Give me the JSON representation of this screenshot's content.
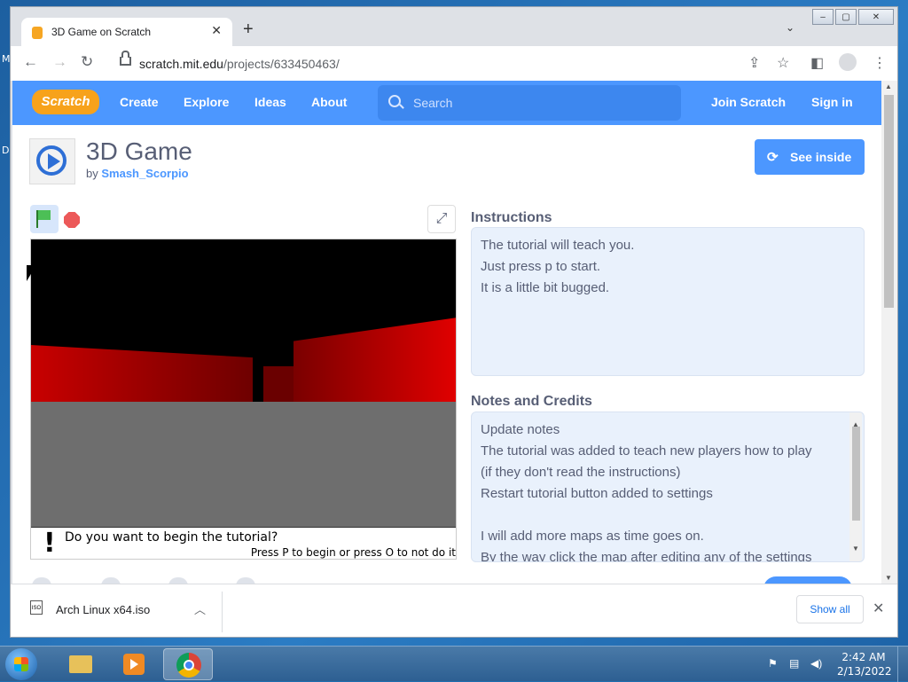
{
  "desktop": {
    "letters": [
      "M",
      "D"
    ]
  },
  "browser": {
    "tab_title": "3D Game on Scratch",
    "new_tab": "+",
    "tab_search_icon": "chevron-down-icon",
    "url_host": "scratch.mit.edu",
    "url_path": "/projects/633450463/",
    "window_controls": [
      "‒",
      "▢",
      "✕"
    ]
  },
  "scratch": {
    "logo": "Scratch",
    "nav": {
      "create": "Create",
      "explore": "Explore",
      "ideas": "Ideas",
      "about": "About"
    },
    "search_placeholder": "Search",
    "join": "Join Scratch",
    "signin": "Sign in",
    "accent": "#4c97ff"
  },
  "project": {
    "title": "3D Game",
    "by": "by",
    "author": "Smash_Scorpio",
    "see_inside": "See inside",
    "stage": {
      "question": "Do you want to begin the tutorial?",
      "answer_hint": "Press P to begin or press O to not do it",
      "exclamation": "!"
    },
    "instructions_heading": "Instructions",
    "instructions": [
      "The tutorial will teach you.",
      "Just press p to start.",
      "It is a little bit bugged."
    ],
    "notes_heading": "Notes and Credits",
    "notes": [
      "Update notes",
      "The tutorial was added to teach new players how to play",
      "(if they don't read the instructions)",
      "Restart tutorial button added to settings",
      "",
      "I will add more maps as time goes on.",
      "By the way click the map after editing any of the settings"
    ]
  },
  "downloads": {
    "file": "Arch Linux x64.iso",
    "show_all": "Show all"
  },
  "taskbar": {
    "time": "2:42 AM",
    "date": "2/13/2022"
  }
}
